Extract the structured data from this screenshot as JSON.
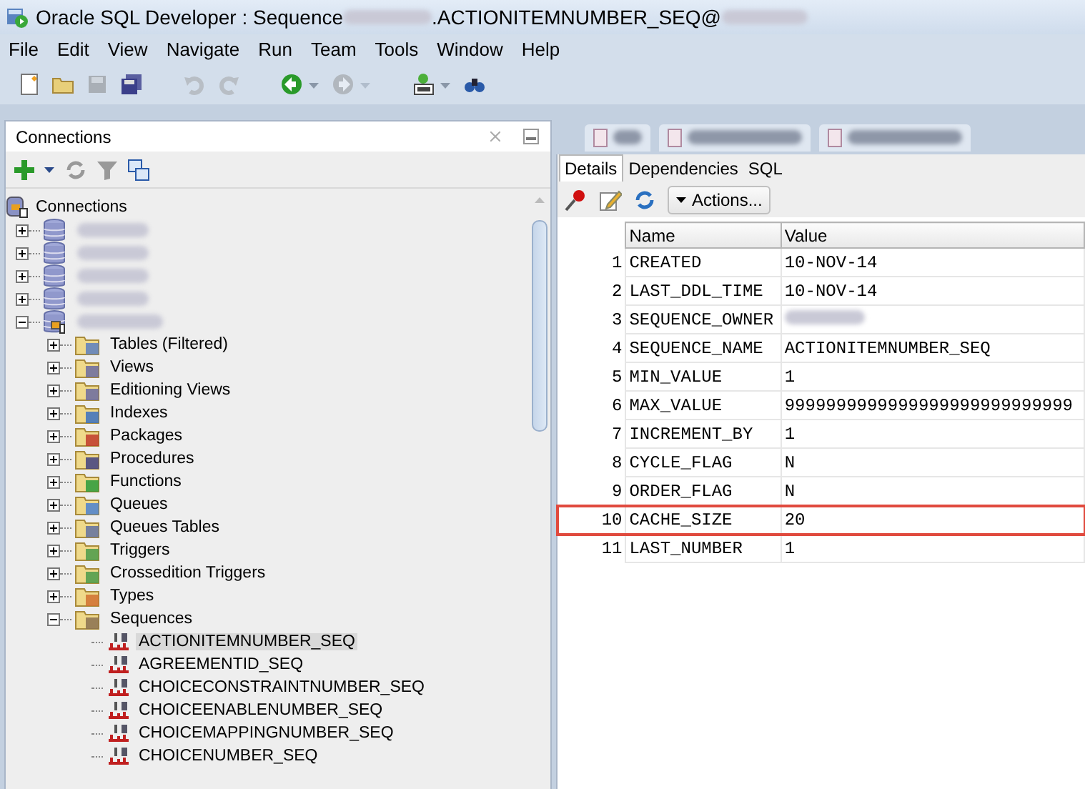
{
  "window": {
    "title_prefix": "Oracle SQL Developer : Sequence ",
    "title_suffix": ".ACTIONITEMNUMBER_SEQ@"
  },
  "menu": [
    "File",
    "Edit",
    "View",
    "Navigate",
    "Run",
    "Team",
    "Tools",
    "Window",
    "Help"
  ],
  "toolbar": [
    {
      "kind": "new",
      "disabled": false,
      "dropdown": false
    },
    {
      "kind": "open",
      "disabled": false,
      "dropdown": false
    },
    {
      "kind": "save",
      "disabled": true,
      "dropdown": false
    },
    {
      "kind": "save-all",
      "disabled": false,
      "dropdown": false
    },
    {
      "kind": "undo",
      "disabled": true,
      "dropdown": false
    },
    {
      "kind": "redo",
      "disabled": true,
      "dropdown": false
    },
    {
      "kind": "back",
      "disabled": false,
      "dropdown": true
    },
    {
      "kind": "forward",
      "disabled": true,
      "dropdown": true
    },
    {
      "kind": "sql",
      "disabled": false,
      "dropdown": true
    },
    {
      "kind": "find",
      "disabled": false,
      "dropdown": false
    }
  ],
  "connections_panel": {
    "title": "Connections",
    "tree": {
      "label": "Connections",
      "kind": "root",
      "children": [
        {
          "kind": "connection",
          "connected": false,
          "expanded": false
        },
        {
          "kind": "connection",
          "connected": false,
          "expanded": false
        },
        {
          "kind": "connection",
          "connected": false,
          "expanded": false
        },
        {
          "kind": "connection",
          "connected": false,
          "expanded": false
        },
        {
          "kind": "connection",
          "connected": true,
          "expanded": true,
          "children": [
            {
              "label": "Tables (Filtered)",
              "kind": "tables",
              "expanded": false
            },
            {
              "label": "Views",
              "kind": "views",
              "expanded": false
            },
            {
              "label": "Editioning Views",
              "kind": "views",
              "expanded": false
            },
            {
              "label": "Indexes",
              "kind": "indexes",
              "expanded": false
            },
            {
              "label": "Packages",
              "kind": "packages",
              "expanded": false
            },
            {
              "label": "Procedures",
              "kind": "procedures",
              "expanded": false
            },
            {
              "label": "Functions",
              "kind": "functions",
              "expanded": false
            },
            {
              "label": "Queues",
              "kind": "queues",
              "expanded": false
            },
            {
              "label": "Queues Tables",
              "kind": "queue-tables",
              "expanded": false
            },
            {
              "label": "Triggers",
              "kind": "triggers",
              "expanded": false
            },
            {
              "label": "Crossedition Triggers",
              "kind": "triggers",
              "expanded": false
            },
            {
              "label": "Types",
              "kind": "types",
              "expanded": false
            },
            {
              "label": "Sequences",
              "kind": "sequences",
              "expanded": true,
              "children": [
                {
                  "label": "ACTIONITEMNUMBER_SEQ",
                  "kind": "sequence",
                  "selected": true
                },
                {
                  "label": "AGREEMENTID_SEQ",
                  "kind": "sequence",
                  "selected": false
                },
                {
                  "label": "CHOICECONSTRAINTNUMBER_SEQ",
                  "kind": "sequence",
                  "selected": false
                },
                {
                  "label": "CHOICEENABLENUMBER_SEQ",
                  "kind": "sequence",
                  "selected": false
                },
                {
                  "label": "CHOICEMAPPINGNUMBER_SEQ",
                  "kind": "sequence",
                  "selected": false
                },
                {
                  "label": "CHOICENUMBER_SEQ",
                  "kind": "sequence",
                  "selected": false
                }
              ]
            }
          ]
        }
      ]
    }
  },
  "editor": {
    "tabs": [
      {
        "kind": "sql"
      },
      {
        "kind": "sql"
      },
      {
        "kind": "sql"
      }
    ],
    "subtabs": [
      {
        "label": "Details",
        "selected": true
      },
      {
        "label": "Dependencies",
        "selected": false
      },
      {
        "label": "SQL",
        "selected": false
      }
    ],
    "actions_button": "Actions...",
    "table": {
      "columns": [
        "Name",
        "Value"
      ],
      "rows": [
        {
          "index": "1",
          "name": "CREATED",
          "value": "10-NOV-14",
          "highlighted": false
        },
        {
          "index": "2",
          "name": "LAST_DDL_TIME",
          "value": "10-NOV-14",
          "highlighted": false
        },
        {
          "index": "3",
          "name": "SEQUENCE_OWNER",
          "redacted": true,
          "highlighted": false
        },
        {
          "index": "4",
          "name": "SEQUENCE_NAME",
          "value": "ACTIONITEMNUMBER_SEQ",
          "highlighted": false
        },
        {
          "index": "5",
          "name": "MIN_VALUE",
          "value": "1",
          "highlighted": false
        },
        {
          "index": "6",
          "name": "MAX_VALUE",
          "value": "9999999999999999999999999999",
          "highlighted": false
        },
        {
          "index": "7",
          "name": "INCREMENT_BY",
          "value": "1",
          "highlighted": false
        },
        {
          "index": "8",
          "name": "CYCLE_FLAG",
          "value": "N",
          "highlighted": false
        },
        {
          "index": "9",
          "name": "ORDER_FLAG",
          "value": "N",
          "highlighted": false
        },
        {
          "index": "10",
          "name": "CACHE_SIZE",
          "value": "20",
          "highlighted": true
        },
        {
          "index": "11",
          "name": "LAST_NUMBER",
          "value": "1",
          "highlighted": false
        }
      ]
    }
  }
}
